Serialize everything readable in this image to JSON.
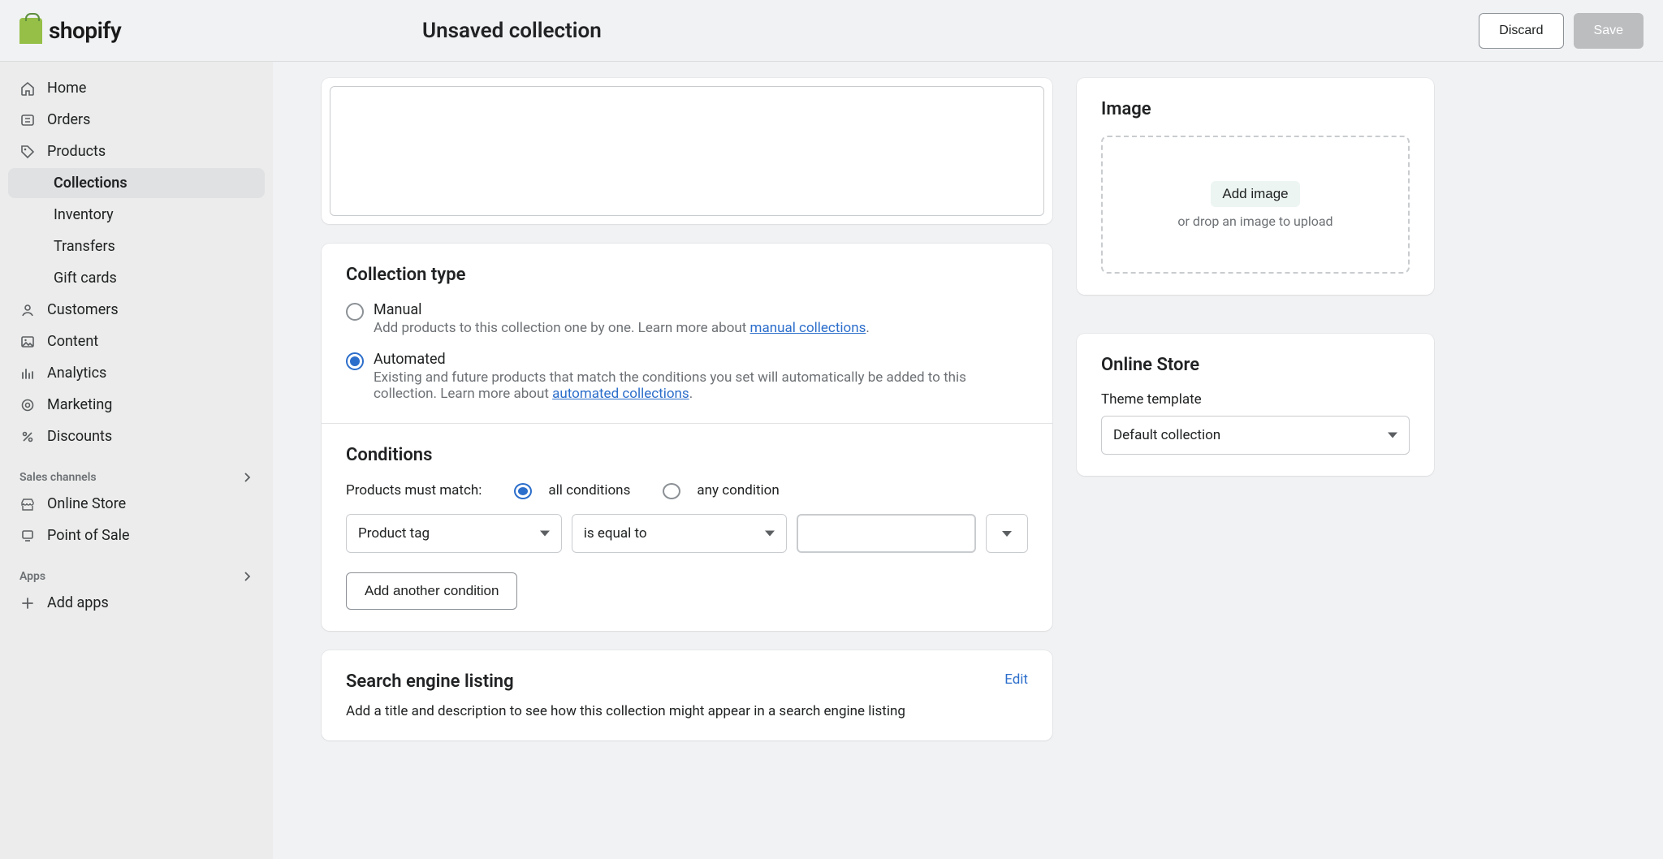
{
  "brand": {
    "name": "shopify"
  },
  "header": {
    "page_title": "Unsaved collection",
    "discard": "Discard",
    "save": "Save"
  },
  "sidebar": {
    "items": [
      {
        "label": "Home"
      },
      {
        "label": "Orders"
      },
      {
        "label": "Products"
      },
      {
        "label": "Collections"
      },
      {
        "label": "Inventory"
      },
      {
        "label": "Transfers"
      },
      {
        "label": "Gift cards"
      },
      {
        "label": "Customers"
      },
      {
        "label": "Content"
      },
      {
        "label": "Analytics"
      },
      {
        "label": "Marketing"
      },
      {
        "label": "Discounts"
      }
    ],
    "sales_channels_label": "Sales channels",
    "sales_channels": [
      {
        "label": "Online Store"
      },
      {
        "label": "Point of Sale"
      }
    ],
    "apps_label": "Apps",
    "app_items": [
      {
        "label": "Add apps"
      }
    ]
  },
  "collection_type": {
    "heading": "Collection type",
    "manual": {
      "label": "Manual",
      "desc_prefix": "Add products to this collection one by one. Learn more about ",
      "desc_link": "manual collections",
      "desc_suffix": "."
    },
    "automated": {
      "label": "Automated",
      "desc_prefix": "Existing and future products that match the conditions you set will automatically be added to this collection. Learn more about ",
      "desc_link": "automated collections",
      "desc_suffix": "."
    }
  },
  "conditions": {
    "heading": "Conditions",
    "match_label": "Products must match:",
    "match_all": "all conditions",
    "match_any": "any condition",
    "row": {
      "field": "Product tag",
      "operator": "is equal to",
      "value": ""
    },
    "add_button": "Add another condition"
  },
  "seo": {
    "heading": "Search engine listing",
    "edit": "Edit",
    "desc": "Add a title and description to see how this collection might appear in a search engine listing"
  },
  "image_card": {
    "heading": "Image",
    "add_button": "Add image",
    "hint": "or drop an image to upload"
  },
  "online_store": {
    "heading": "Online Store",
    "theme_label": "Theme template",
    "theme_value": "Default collection"
  }
}
